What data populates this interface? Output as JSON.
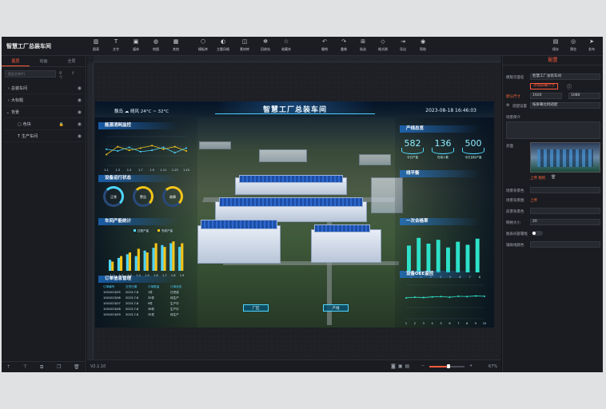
{
  "app": {
    "title": "智慧工厂总装车间"
  },
  "toolbar": {
    "items": [
      {
        "label": "图表",
        "icon": "chart-icon"
      },
      {
        "label": "文字",
        "icon": "text-icon"
      },
      {
        "label": "媒体",
        "icon": "media-icon"
      },
      {
        "label": "地图",
        "icon": "map-icon"
      },
      {
        "label": "其他",
        "icon": "other-icon"
      },
      {
        "label": "模板库",
        "icon": "template-icon"
      },
      {
        "label": "主题风格",
        "icon": "theme-icon"
      },
      {
        "label": "素材库",
        "icon": "material-icon"
      },
      {
        "label": "回收站",
        "icon": "recycle-icon"
      },
      {
        "label": "收藏夹",
        "icon": "star-icon"
      },
      {
        "label": "撤销",
        "icon": "undo-icon"
      },
      {
        "label": "重做",
        "icon": "redo-icon"
      },
      {
        "label": "粘选",
        "icon": "paste-icon"
      },
      {
        "label": "格式刷",
        "icon": "brush-icon"
      },
      {
        "label": "导出",
        "icon": "export-icon"
      },
      {
        "label": "帮助",
        "icon": "help-icon"
      }
    ],
    "right": [
      {
        "label": "保存",
        "icon": "save-icon"
      },
      {
        "label": "预览",
        "icon": "preview-icon"
      },
      {
        "label": "发布",
        "icon": "publish-icon"
      }
    ]
  },
  "left": {
    "tabs": [
      "图层",
      "动画",
      "全局"
    ],
    "search_placeholder": "图层名称(F)",
    "layers": [
      {
        "label": "总装车间",
        "expander": "›"
      },
      {
        "label": "大标题",
        "expander": "›"
      },
      {
        "label": "背景",
        "expander": "⌄"
      },
      {
        "label": "色块",
        "expander": ""
      },
      {
        "label": "生产车间",
        "expander": ""
      }
    ]
  },
  "status": {
    "version": "V2.1.10",
    "zoom": "67%"
  },
  "right": {
    "title": "配置",
    "page_name_label": "模版页面名",
    "page_name_value": "智慧工厂总装车间",
    "add_size_btn": "添加屏幕尺寸",
    "size_label": "默认尺寸",
    "width": "1920",
    "height": "1080",
    "adapt_label": "适配设置",
    "adapt_value": "按屏幕比例适配",
    "intro_label": "场景简介",
    "cover_label": "封面",
    "cover_actions": "上传  相机",
    "bg_color_label": "场景背景色",
    "bg_image_label": "场景背景图",
    "bg_image_action": "上传",
    "bg_opacity_label": "前景背景色",
    "grid_label": "网格大小",
    "grid_value": "20",
    "toggle_label": "图表间部署框",
    "guide_label": "辅助线颜色"
  },
  "dashboard": {
    "title": "智慧工厂总装车间",
    "weather": "飘岛  ☁ 晴风 24°C ~ 32°C",
    "time": "2023-08-18  16:46:03",
    "panels": {
      "energy": "能源消耗监控",
      "equipment": "设备运行状态",
      "production": "车间产能统计",
      "orders": "订单信息管理",
      "output": "产线总览",
      "line_stats": "线平衡",
      "oee": "设备OEE监控",
      "pass_rate": "一次合格率"
    },
    "stats": [
      {
        "value": "582",
        "label": "今日产量"
      },
      {
        "value": "136",
        "label": "在线人数"
      },
      {
        "value": "500",
        "label": "今日目标产量"
      }
    ],
    "rings": [
      "正常",
      "警告",
      "故障"
    ],
    "orders": {
      "header": [
        "订单编号",
        "交货日期",
        "订单数量",
        "订单状态"
      ],
      "rows": [
        [
          "1001023/05",
          "2023-7-8",
          "1件",
          "已完成"
        ],
        [
          "1001023/06",
          "2023-7-8",
          "35件",
          "待生产"
        ],
        [
          "1001023/07",
          "2023-7-8",
          "9件",
          "生产中"
        ],
        [
          "1001023/08",
          "2023-7-8",
          "38件",
          "生产中"
        ],
        [
          "1001023/09",
          "2023-7-8",
          "35件",
          "待生产"
        ]
      ]
    },
    "buttons": {
      "factory": "厂区",
      "line": "产线"
    }
  },
  "chart_data": [
    {
      "type": "line",
      "title": "能源消耗监控",
      "x": [
        "1.1",
        "1.3",
        "1.5",
        "1.7",
        "1.9",
        "1.11",
        "1.13",
        "1.15"
      ],
      "series": [
        {
          "name": "",
          "values": [
            30,
            52,
            42,
            48,
            55,
            45,
            52,
            40
          ]
        },
        {
          "name": "",
          "values": [
            45,
            40,
            50,
            38,
            42,
            50,
            35,
            48
          ]
        }
      ],
      "ylim": [
        0,
        80
      ]
    },
    {
      "type": "bar",
      "title": "车间产能统计",
      "categories": [
        "1.1",
        "1.2",
        "1.3",
        "1.4",
        "1.5",
        "1.6",
        "1.7",
        "1.8",
        "1.9"
      ],
      "series": [
        {
          "name": "过程产量",
          "values": [
            12,
            14,
            18,
            16,
            22,
            25,
            28,
            30,
            26
          ]
        },
        {
          "name": "完成产量",
          "values": [
            10,
            16,
            20,
            24,
            20,
            30,
            26,
            32,
            30
          ]
        }
      ],
      "ylim": [
        0,
        40
      ]
    },
    {
      "type": "line",
      "title": "设备OEE监控",
      "x": [
        "1",
        "2",
        "3",
        "4",
        "5",
        "6",
        "7",
        "8",
        "9",
        "10"
      ],
      "series": [
        {
          "name": "",
          "values": [
            62,
            64,
            63,
            65,
            66,
            64,
            67,
            66,
            68,
            67
          ]
        }
      ],
      "ylim": [
        0,
        100
      ]
    },
    {
      "type": "bar",
      "title": "一次合格率",
      "categories": [
        "1",
        "2",
        "3",
        "4",
        "5",
        "6",
        "7",
        "8"
      ],
      "series": [
        {
          "name": "",
          "values": [
            70,
            90,
            75,
            85,
            65,
            80,
            72,
            88
          ]
        }
      ],
      "ylim": [
        0,
        100
      ]
    }
  ]
}
